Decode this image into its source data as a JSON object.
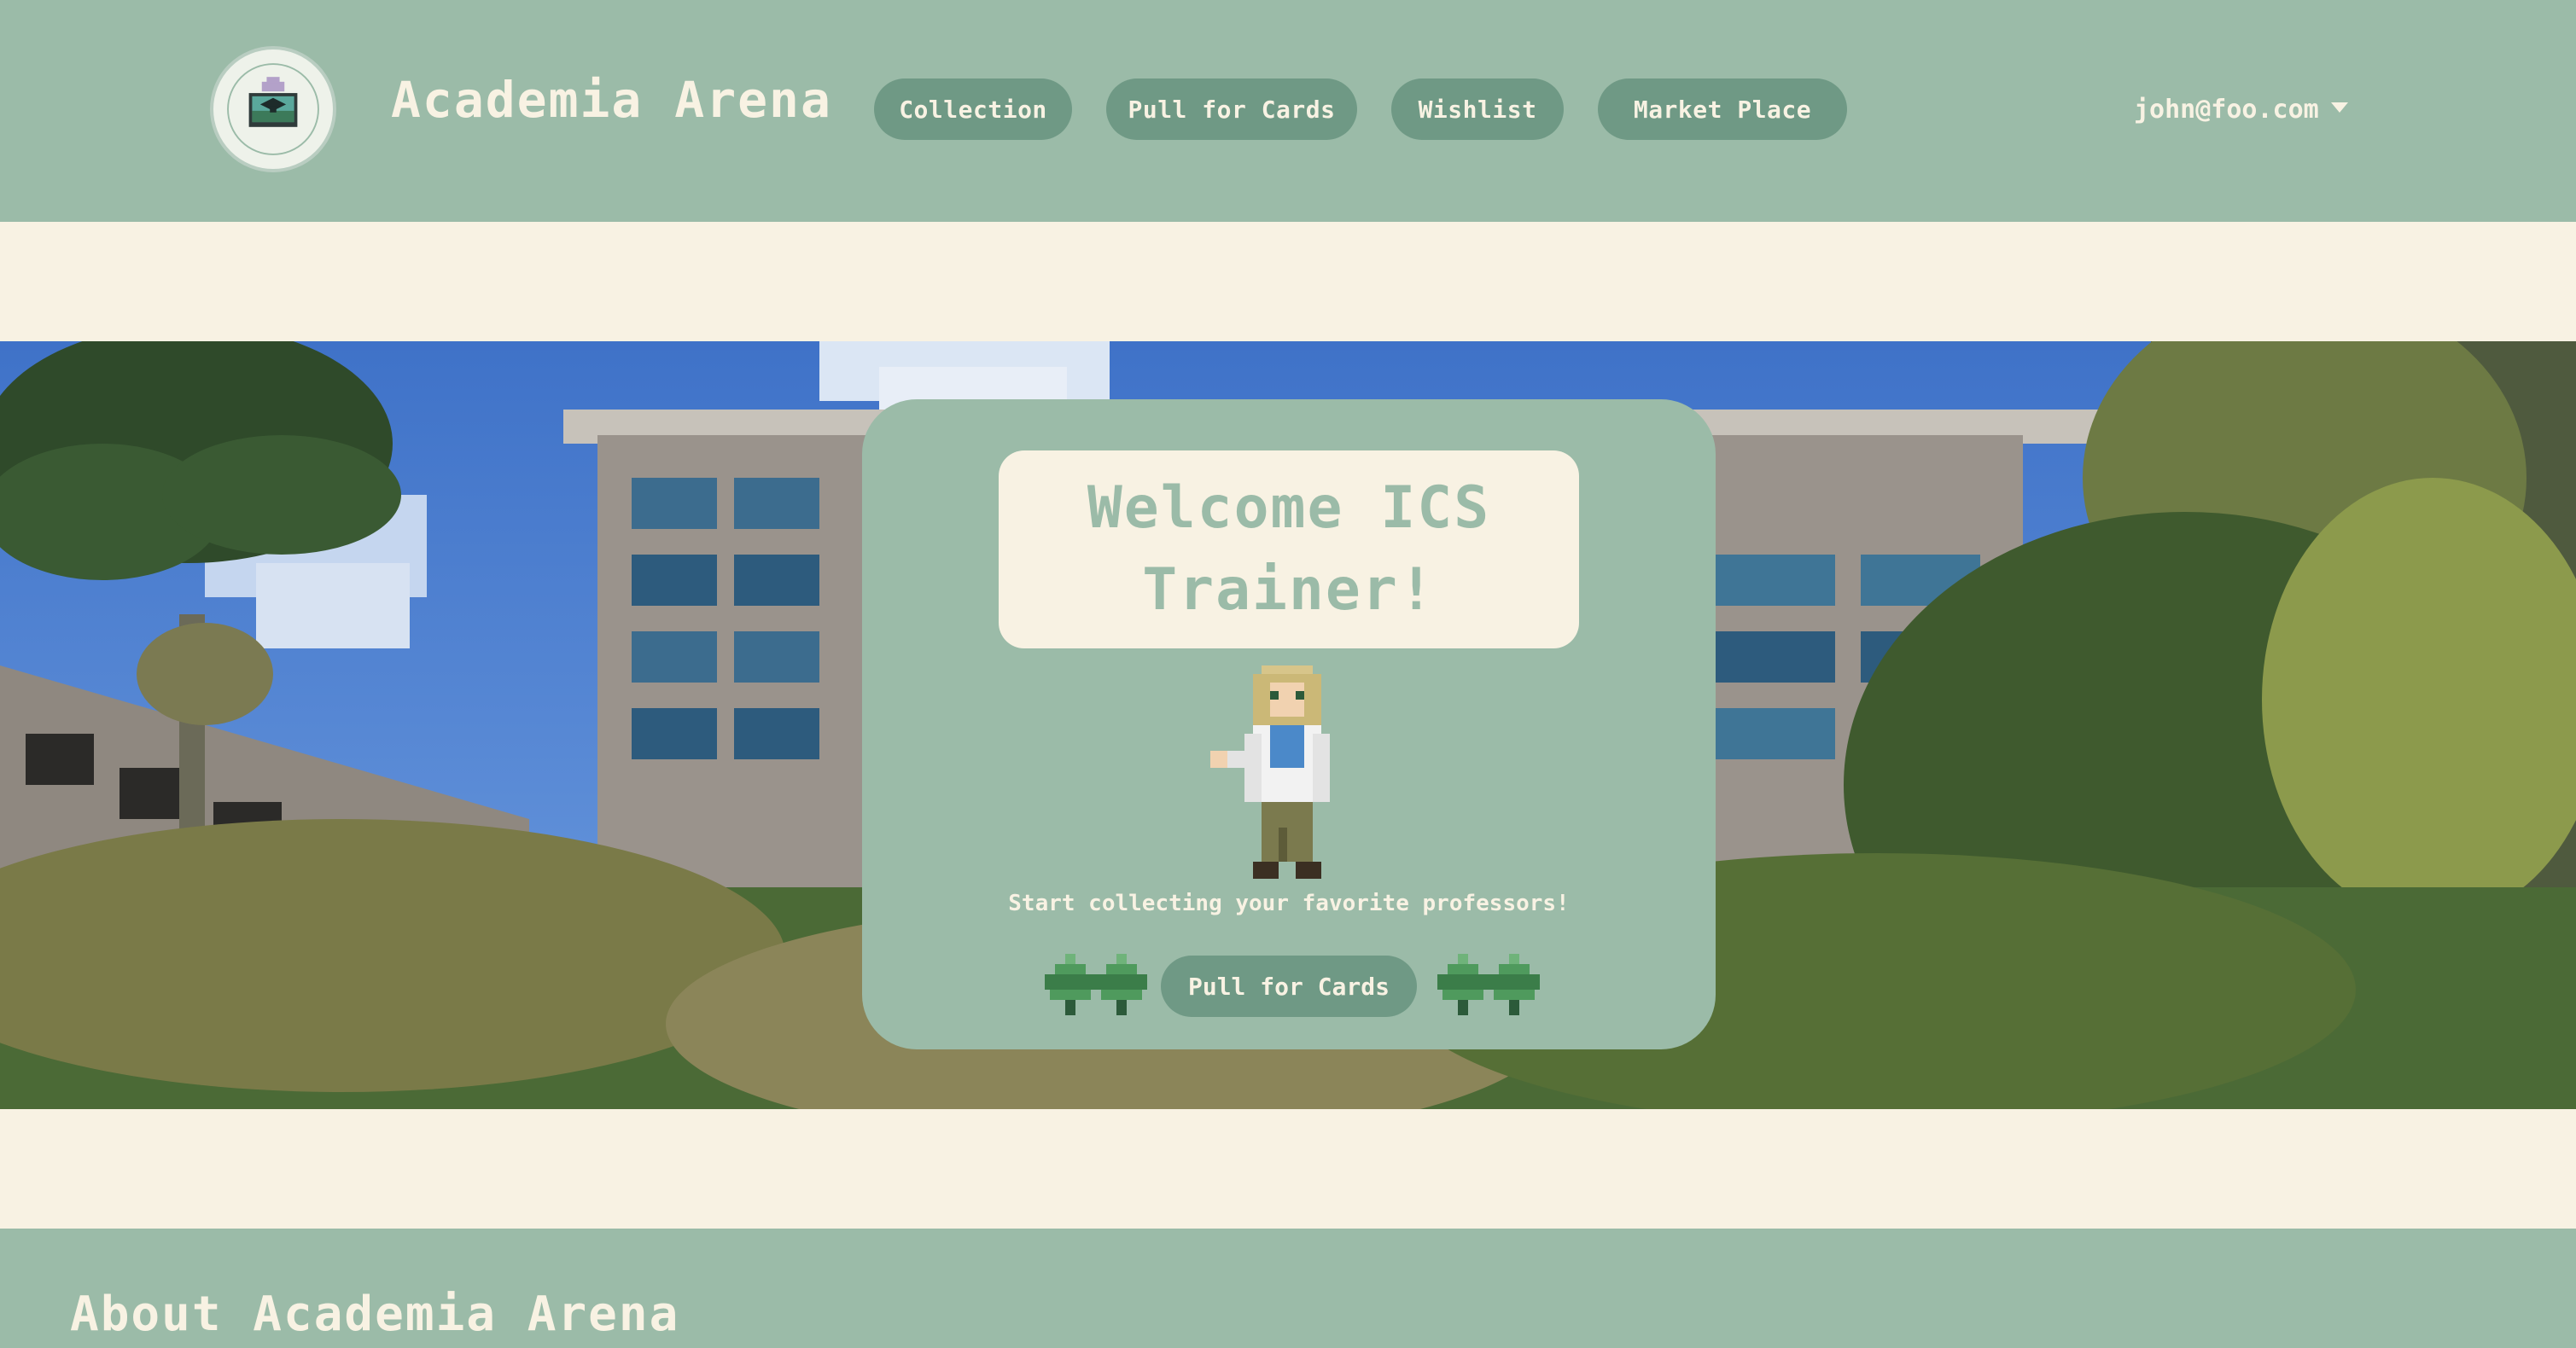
{
  "navbar": {
    "brand": "Academia Arena",
    "logo_icon": "academia-arena-logo",
    "links": [
      {
        "label": "Collection"
      },
      {
        "label": "Pull for Cards"
      },
      {
        "label": "Wishlist"
      },
      {
        "label": "Market Place"
      }
    ],
    "user": {
      "email": "john@foo.com",
      "icon": "chevron-down-icon"
    }
  },
  "hero": {
    "title": "Welcome ICS Trainer!",
    "tagline": "Start collecting your favorite professors!",
    "button_label": "Pull for Cards",
    "decor_icons": [
      "leaf-icon",
      "leaf-icon"
    ]
  },
  "about": {
    "title": "About Academia Arena"
  },
  "colors": {
    "primary": "#9bbba8",
    "pill": "#6f9985",
    "cream": "#f8f2e3"
  }
}
